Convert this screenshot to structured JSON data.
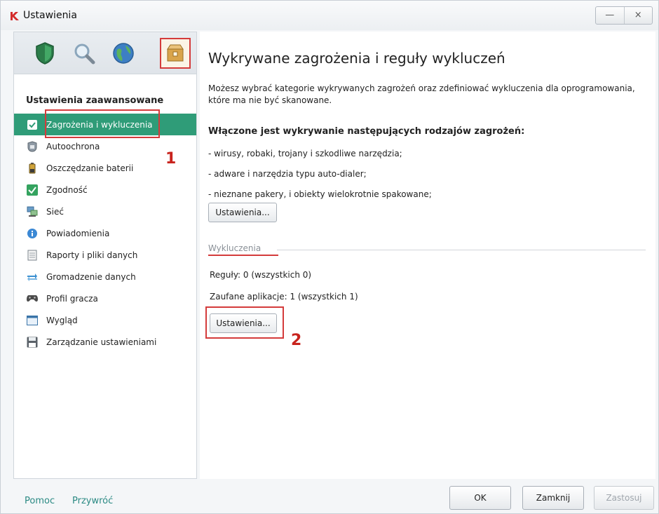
{
  "window": {
    "title": "Ustawienia",
    "minimize": "—",
    "close": "×"
  },
  "sidebar": {
    "section_title": "Ustawienia zaawansowane",
    "items": [
      {
        "label": "Zagrożenia i wykluczenia",
        "icon": "check-shield-icon",
        "selected": true
      },
      {
        "label": "Autoochrona",
        "icon": "self-defense-icon"
      },
      {
        "label": "Oszczędzanie baterii",
        "icon": "battery-icon"
      },
      {
        "label": "Zgodność",
        "icon": "compatibility-icon"
      },
      {
        "label": "Sieć",
        "icon": "network-icon"
      },
      {
        "label": "Powiadomienia",
        "icon": "notification-icon"
      },
      {
        "label": "Raporty i pliki danych",
        "icon": "reports-icon"
      },
      {
        "label": "Gromadzenie danych",
        "icon": "data-collection-icon"
      },
      {
        "label": "Profil gracza",
        "icon": "gamepad-icon"
      },
      {
        "label": "Wygląd",
        "icon": "appearance-icon"
      },
      {
        "label": "Zarządzanie ustawieniami",
        "icon": "save-icon"
      }
    ]
  },
  "annotations": {
    "marker1": "1",
    "marker2": "2"
  },
  "main": {
    "title": "Wykrywane zagrożenia i reguły wykluczeń",
    "description": "Możesz wybrać kategorie wykrywanych zagrożeń oraz zdefiniować wykluczenia dla oprogramowania, które ma nie być skanowane.",
    "enabled_heading": "Włączone jest wykrywanie następujących rodzajów zagrożeń:",
    "threats": [
      "- wirusy, robaki, trojany i szkodliwe narzędzia;",
      "- adware i narzędzia typu auto-dialer;",
      "- nieznane pakery, i obiekty wielokrotnie spakowane;"
    ],
    "settings_button": "Ustawienia...",
    "exclusions_group": "Wykluczenia",
    "rules": "Reguły: 0 (wszystkich 0)",
    "trusted_apps": "Zaufane aplikacje: 1 (wszystkich 1)",
    "exclusions_settings_button": "Ustawienia..."
  },
  "footer": {
    "help": "Pomoc",
    "restore": "Przywróć",
    "ok": "OK",
    "close": "Zamknij",
    "apply": "Zastosuj"
  },
  "colors": {
    "accent_green": "#2f9c78",
    "annotation_red": "#d43b3b",
    "link_teal": "#2b8a84"
  }
}
